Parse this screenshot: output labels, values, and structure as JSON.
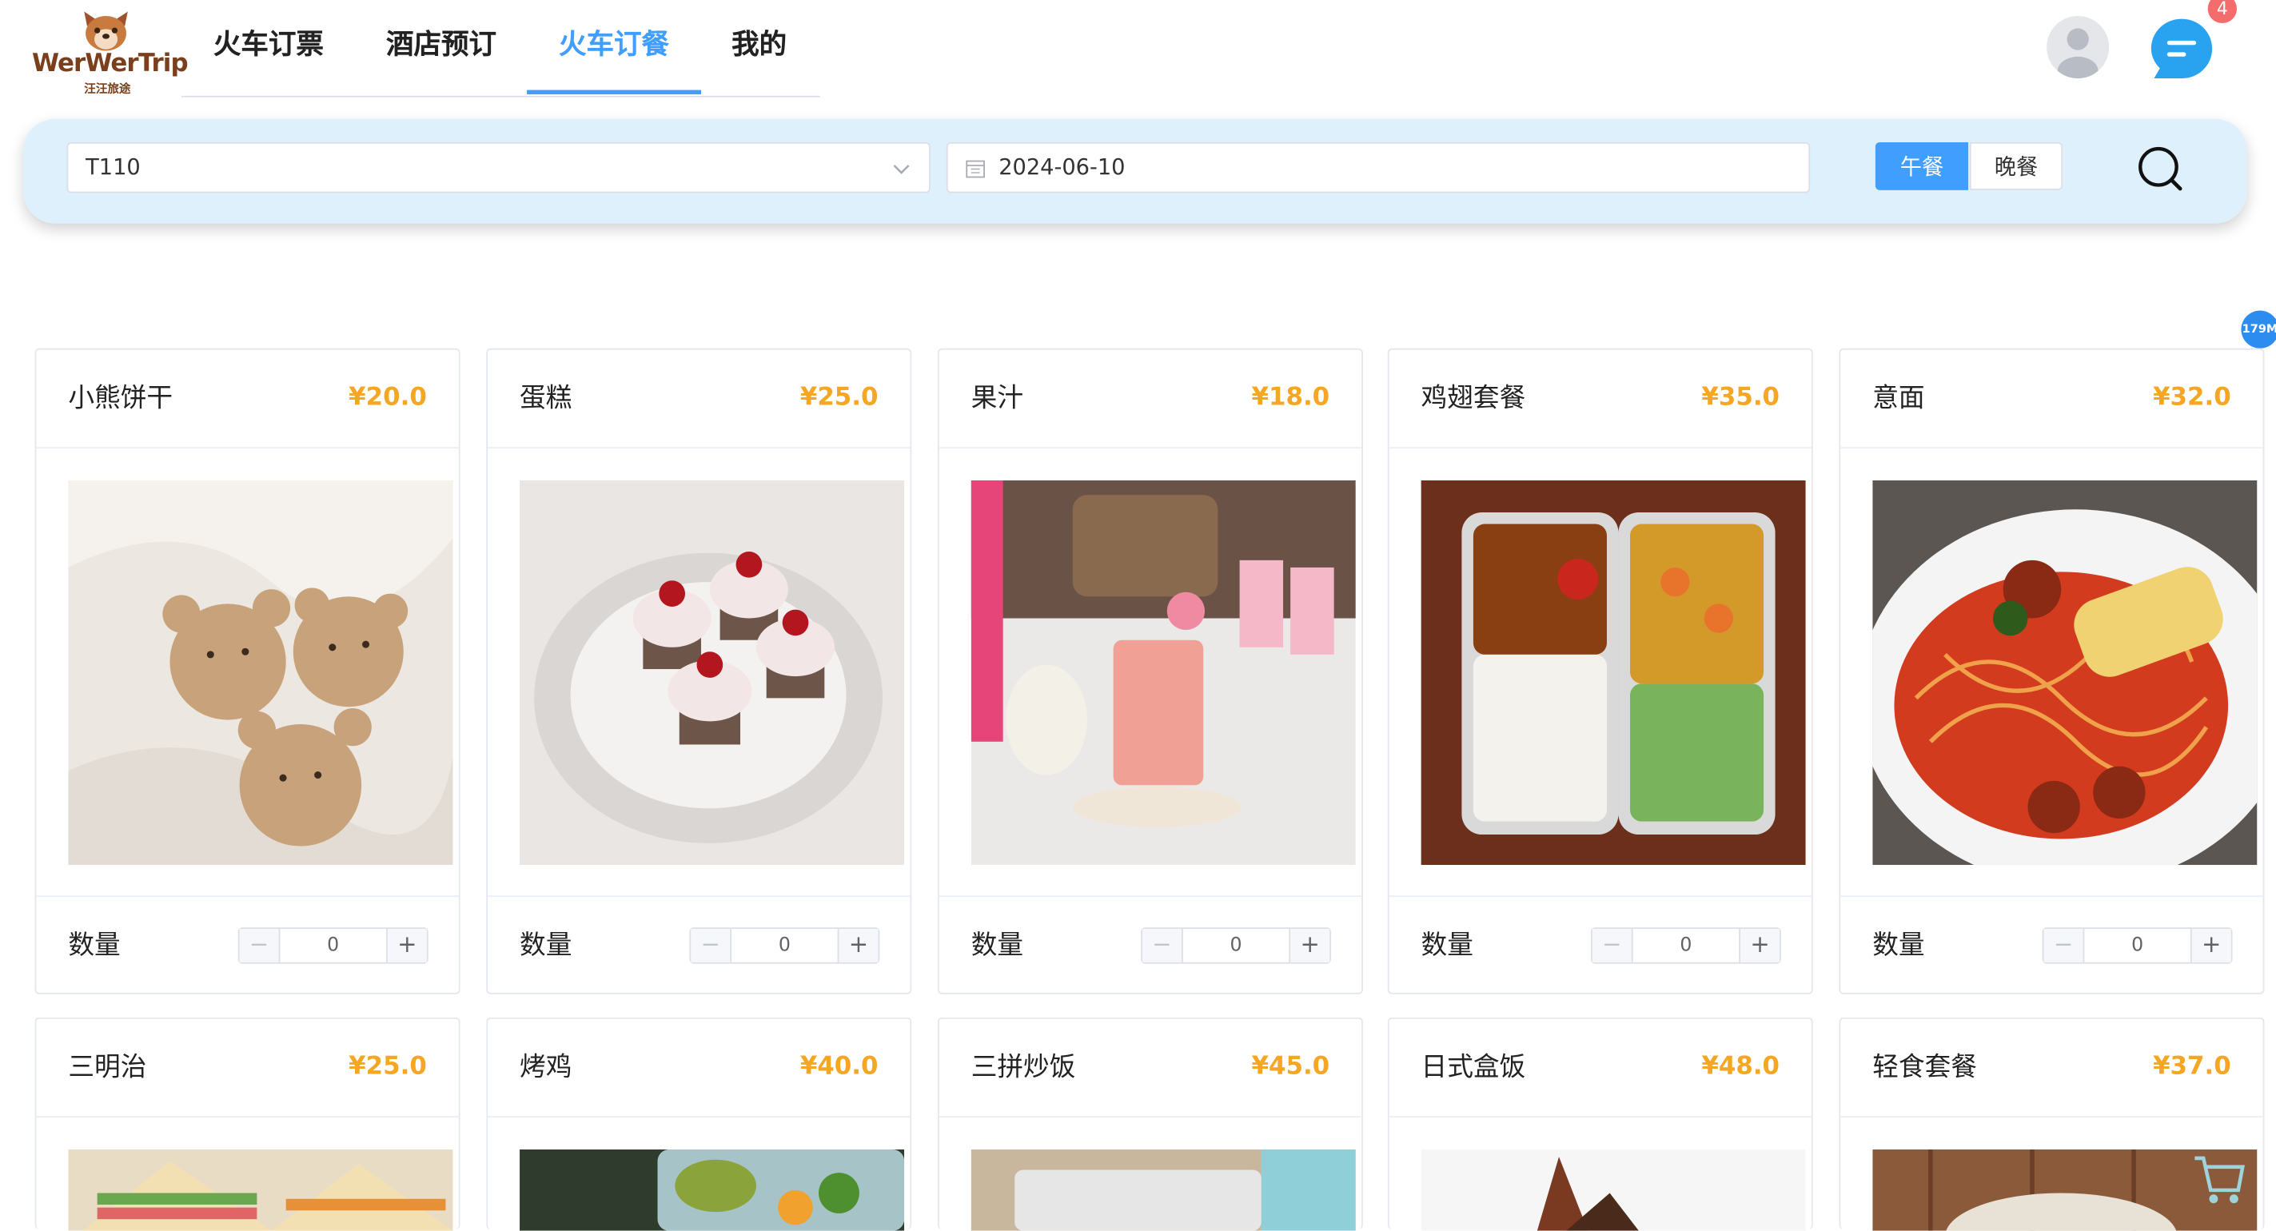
{
  "header": {
    "logo_text": "WerWerTrip",
    "logo_sub": "汪汪旅途",
    "nav": [
      "火车订票",
      "酒店预订",
      "火车订餐",
      "我的"
    ],
    "active_nav": "火车订餐",
    "message_badge": "4"
  },
  "search": {
    "train": "T110",
    "date": "2024-06-10",
    "meal_tabs": [
      "午餐",
      "晚餐"
    ],
    "selected_meal": "午餐"
  },
  "float_pill": "179M",
  "quantity_label": "数量",
  "products": [
    {
      "name": "小熊饼干",
      "price": "¥20.0",
      "qty": "0",
      "image": "bear-cookies-photo"
    },
    {
      "name": "蛋糕",
      "price": "¥25.0",
      "qty": "0",
      "image": "cherry-cupcakes-photo"
    },
    {
      "name": "果汁",
      "price": "¥18.0",
      "qty": "0",
      "image": "juice-glass-photo"
    },
    {
      "name": "鸡翅套餐",
      "price": "¥35.0",
      "qty": "0",
      "image": "chicken-wing-bento-photo"
    },
    {
      "name": "意面",
      "price": "¥32.0",
      "qty": "0",
      "image": "spaghetti-meatballs-photo"
    },
    {
      "name": "三明治",
      "price": "¥25.0",
      "qty": "",
      "image": "sandwich-photo"
    },
    {
      "name": "烤鸡",
      "price": "¥40.0",
      "qty": "",
      "image": "roast-chicken-photo"
    },
    {
      "name": "三拼炒饭",
      "price": "¥45.0",
      "qty": "",
      "image": "fried-rice-photo"
    },
    {
      "name": "日式盒饭",
      "price": "¥48.0",
      "qty": "",
      "image": "japanese-bento-photo"
    },
    {
      "name": "轻食套餐",
      "price": "¥37.0",
      "qty": "",
      "image": "light-meal-photo"
    }
  ],
  "colors": {
    "accent": "#409eff",
    "price": "#f5a623",
    "badge": "#f56c6c",
    "search_bg": "#dff0fd"
  }
}
